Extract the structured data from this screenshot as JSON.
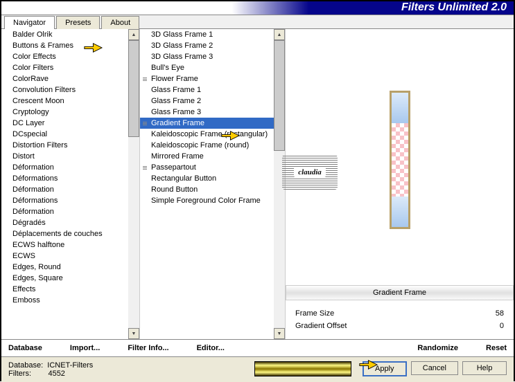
{
  "title": "Filters Unlimited 2.0",
  "tabs": {
    "navigator": "Navigator",
    "presets": "Presets",
    "about": "About"
  },
  "categories": [
    "Balder Olrik",
    "Buttons & Frames",
    "Color Effects",
    "Color Filters",
    "ColorRave",
    "Convolution Filters",
    "Crescent Moon",
    "Cryptology",
    "DC Layer",
    "DCspecial",
    "Distortion Filters",
    "Distort",
    "Déformation",
    "Déformations",
    "Déformation",
    "Déformations",
    "Déformation",
    "Dégradés",
    "Déplacements de couches",
    "ECWS halftone",
    "ECWS",
    "Edges, Round",
    "Edges, Square",
    "Effects",
    "Emboss"
  ],
  "filters": [
    {
      "label": "3D Glass Frame 1",
      "sub": false
    },
    {
      "label": "3D Glass Frame 2",
      "sub": false
    },
    {
      "label": "3D Glass Frame 3",
      "sub": false
    },
    {
      "label": "Bull's Eye",
      "sub": false
    },
    {
      "label": "Flower Frame",
      "sub": true
    },
    {
      "label": "Glass Frame 1",
      "sub": false
    },
    {
      "label": "Glass Frame 2",
      "sub": false
    },
    {
      "label": "Glass Frame 3",
      "sub": false
    },
    {
      "label": "Gradient Frame",
      "sub": true,
      "sel": true
    },
    {
      "label": "Kaleidoscopic Frame (rectangular)",
      "sub": false
    },
    {
      "label": "Kaleidoscopic Frame (round)",
      "sub": false
    },
    {
      "label": "Mirrored Frame",
      "sub": false
    },
    {
      "label": "Passepartout",
      "sub": true
    },
    {
      "label": "Rectangular Button",
      "sub": false
    },
    {
      "label": "Round Button",
      "sub": false
    },
    {
      "label": "Simple Foreground Color Frame",
      "sub": false
    }
  ],
  "preview": {
    "title": "Gradient Frame"
  },
  "params": [
    {
      "name": "Frame Size",
      "value": "58"
    },
    {
      "name": "Gradient Offset",
      "value": "0"
    }
  ],
  "buttons1": {
    "database": "Database",
    "import": "Import...",
    "filterinfo": "Filter Info...",
    "editor": "Editor...",
    "randomize": "Randomize",
    "reset": "Reset"
  },
  "footer": {
    "db_label": "Database:",
    "db_val": "ICNET-Filters",
    "f_label": "Filters:",
    "f_val": "4552"
  },
  "buttons2": {
    "apply": "Apply",
    "cancel": "Cancel",
    "help": "Help"
  },
  "watermark": "claudia"
}
